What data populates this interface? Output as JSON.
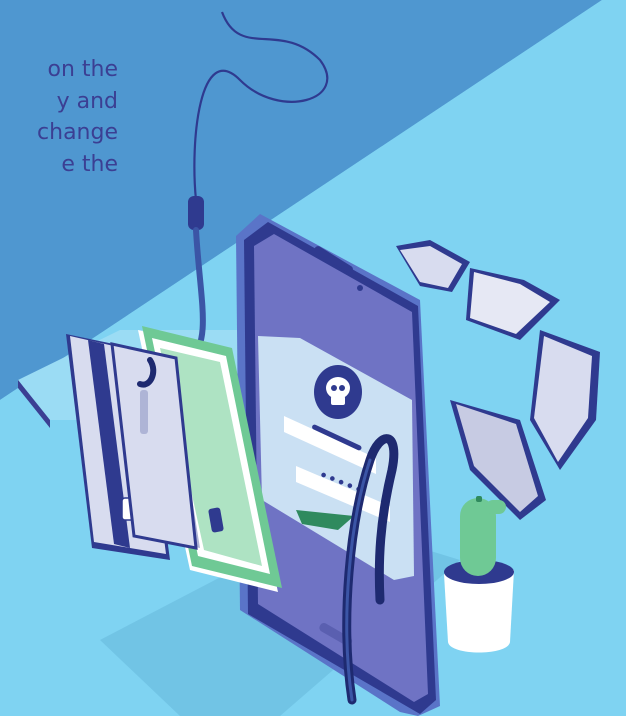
{
  "caption": {
    "lines": [
      "on the",
      "y and",
      "change",
      "e the"
    ]
  },
  "illustration": {
    "phone_password_mask": "•••••",
    "colors": {
      "background_light": "#7fd3f2",
      "background_dark": "#4f97d0",
      "phone_body": "#2f3a8f",
      "phone_screen": "#6f73c4",
      "card_stripe": "#2f3a8f",
      "banknote": "#6fc995",
      "shield": "#d8dcef",
      "cactus": "#6fc995",
      "text": "#3b3f93"
    },
    "icons": [
      "fishing-hook-icon",
      "skull-icon",
      "shield-icon",
      "credit-card-icon",
      "banknote-icon",
      "cactus-icon"
    ]
  }
}
